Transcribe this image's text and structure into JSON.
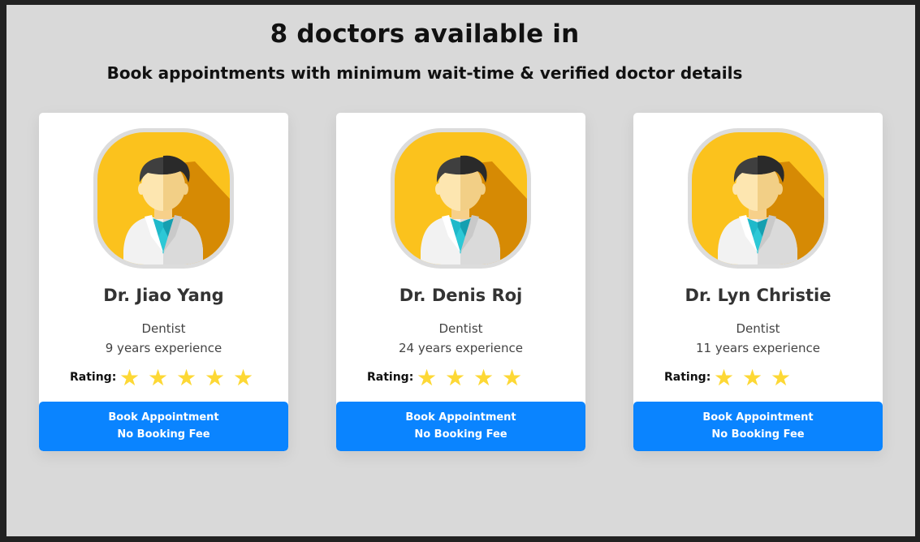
{
  "header": {
    "title": "8 doctors available in",
    "subtitle": "Book appointments with minimum wait-time & verified doctor details"
  },
  "colors": {
    "page_background": "#d9d9d9",
    "card_background": "#ffffff",
    "button_background": "#0a84ff",
    "star": "#fdd835",
    "avatar_background": "#fbc21d"
  },
  "rating_label": "Rating:",
  "star_glyph": "★",
  "doctors": [
    {
      "name": "Dr. Jiao Yang",
      "specialty": "Dentist",
      "experience": "9 years experience",
      "rating": 5,
      "avatar_icon": "doctor-avatar-icon",
      "button": {
        "line1": "Book Appointment",
        "line2": "No Booking Fee"
      }
    },
    {
      "name": "Dr. Denis Roj",
      "specialty": "Dentist",
      "experience": "24 years experience",
      "rating": 4,
      "avatar_icon": "doctor-avatar-icon",
      "button": {
        "line1": "Book Appointment",
        "line2": "No Booking Fee"
      }
    },
    {
      "name": "Dr. Lyn Christie",
      "specialty": "Dentist",
      "experience": "11 years experience",
      "rating": 3,
      "avatar_icon": "doctor-avatar-icon",
      "button": {
        "line1": "Book Appointment",
        "line2": "No Booking Fee"
      }
    }
  ]
}
